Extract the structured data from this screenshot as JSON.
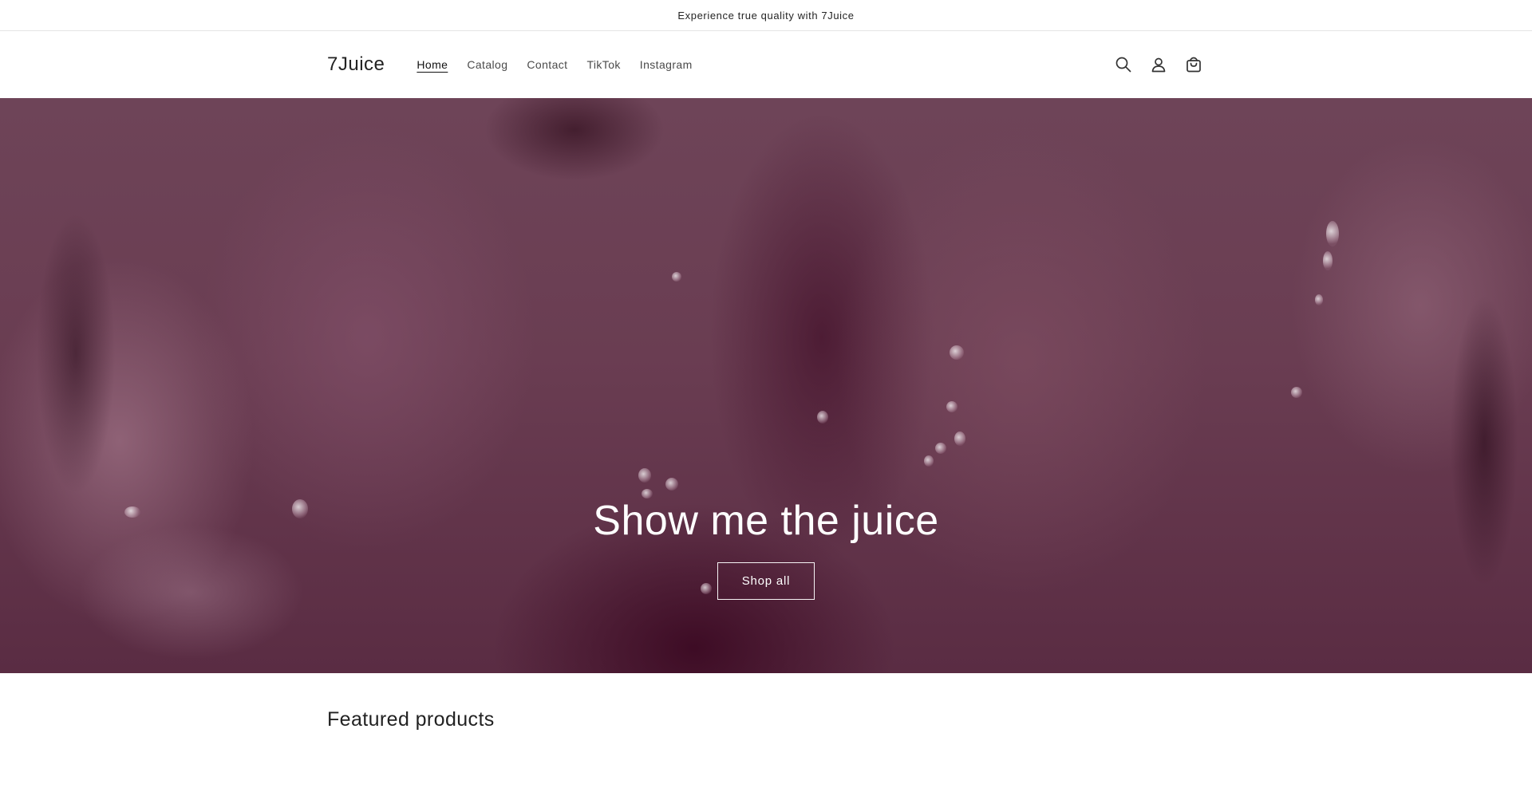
{
  "announcement": {
    "text": "Experience true quality with 7Juice"
  },
  "header": {
    "logo": "7Juice",
    "nav": [
      {
        "label": "Home",
        "active": true
      },
      {
        "label": "Catalog"
      },
      {
        "label": "Contact"
      },
      {
        "label": "TikTok"
      },
      {
        "label": "Instagram"
      }
    ],
    "icons": [
      "search-icon",
      "account-icon",
      "cart-icon"
    ]
  },
  "hero": {
    "title": "Show me the juice",
    "button_label": "Shop all",
    "overlay_color": "#5a2c43"
  },
  "featured": {
    "heading": "Featured products"
  }
}
